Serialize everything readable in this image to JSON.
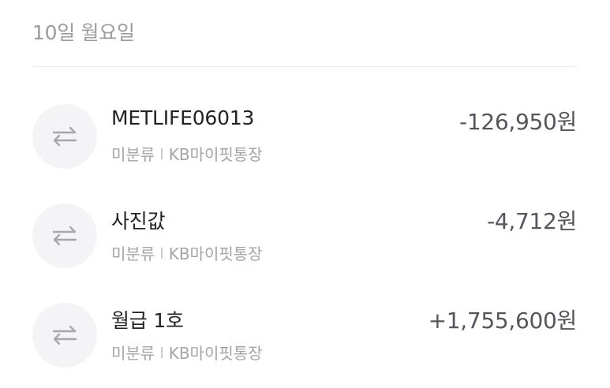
{
  "date_header": "10일 월요일",
  "transactions": [
    {
      "title": "METLIFE06013",
      "category": "미분류",
      "account": "KB마이핏통장",
      "amount": "-126,950원",
      "icon": "transfer-arrows-icon"
    },
    {
      "title": "사진값",
      "category": "미분류",
      "account": "KB마이핏통장",
      "amount": "-4,712원",
      "icon": "transfer-arrows-icon"
    },
    {
      "title": "월급 1호",
      "category": "미분류",
      "account": "KB마이핏통장",
      "amount": "+1,755,600원",
      "icon": "transfer-arrows-icon"
    }
  ],
  "colors": {
    "text_primary": "#222226",
    "text_secondary": "#a4a4aa",
    "amount": "#55555c",
    "icon_bg": "#f4f4f6",
    "icon_stroke": "#a7a7ae"
  }
}
